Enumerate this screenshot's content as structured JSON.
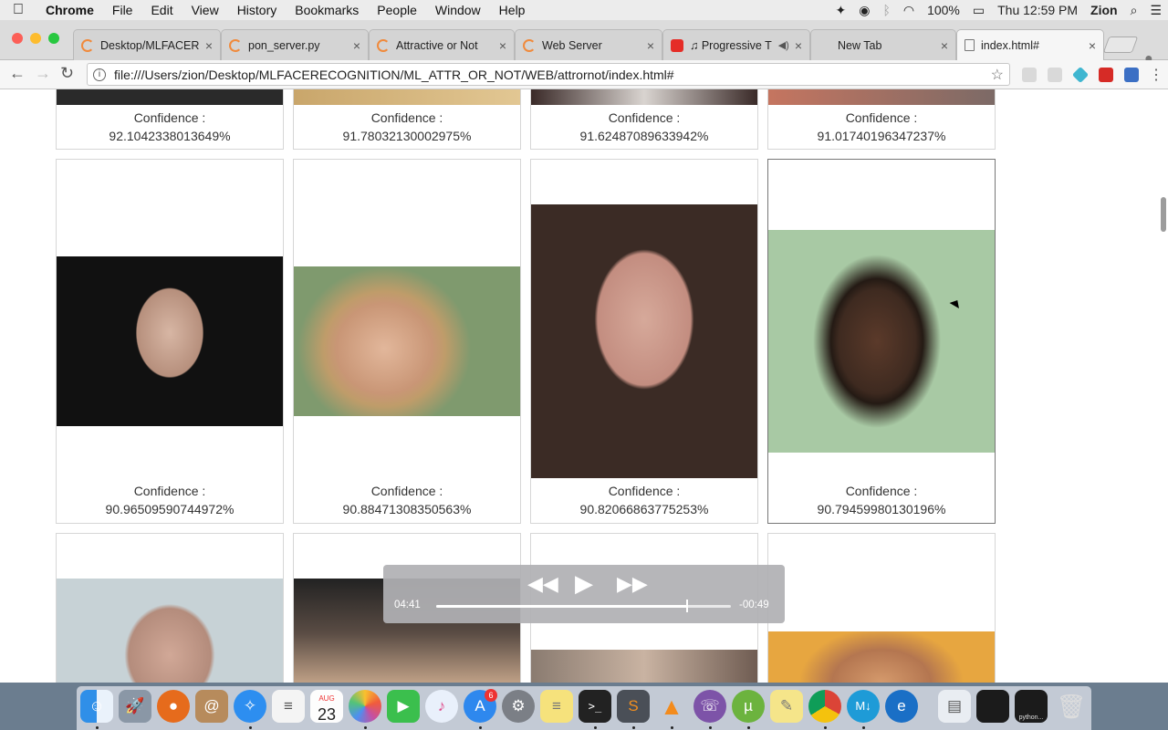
{
  "menubar": {
    "app_name": "Chrome",
    "items": [
      "File",
      "Edit",
      "View",
      "History",
      "Bookmarks",
      "People",
      "Window",
      "Help"
    ],
    "battery": "100%",
    "clock": "Thu 12:59 PM",
    "user": "Zion"
  },
  "tabs": [
    {
      "label": "Desktop/MLFACER",
      "icon": "spinner"
    },
    {
      "label": "pon_server.py",
      "icon": "spinner"
    },
    {
      "label": "Attractive or Not",
      "icon": "spinner"
    },
    {
      "label": "Web Server",
      "icon": "spinner"
    },
    {
      "label": "♫ Progressive T",
      "icon": "youtube"
    },
    {
      "label": "New Tab",
      "icon": "blank"
    },
    {
      "label": "index.html#",
      "icon": "document"
    }
  ],
  "toolbar": {
    "url": "file:///Users/zion/Desktop/MLFACERECOGNITION/ML_ATTR_OR_NOT/WEB/attrornot/index.html#"
  },
  "cards": [
    {
      "label": "Confidence :",
      "value": "92.1042338013649%"
    },
    {
      "label": "Confidence :",
      "value": "91.78032130002975%"
    },
    {
      "label": "Confidence :",
      "value": "91.62487089633942%"
    },
    {
      "label": "Confidence :",
      "value": "91.01740196347237%"
    },
    {
      "label": "Confidence :",
      "value": "90.96509590744972%"
    },
    {
      "label": "Confidence :",
      "value": "90.88471308350563%"
    },
    {
      "label": "Confidence :",
      "value": "90.82066863775253%"
    },
    {
      "label": "Confidence :",
      "value": "90.79459980130196%"
    }
  ],
  "player": {
    "elapsed": "04:41",
    "remaining": "-00:49",
    "progress": 0.85
  },
  "dock": {
    "calendar_month": "AUG",
    "calendar_day": "23",
    "appstore_badge": "6",
    "python_label": "python..."
  },
  "colors": {
    "accent_spinner": "#f08a3c",
    "youtube_red": "#e52d27"
  }
}
